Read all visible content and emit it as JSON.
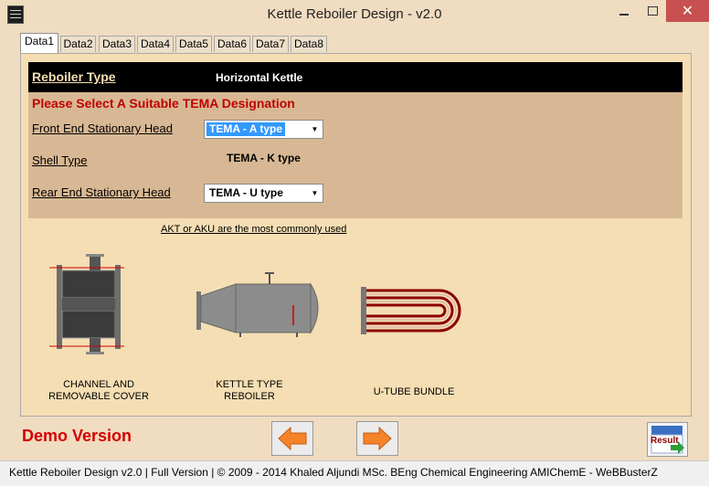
{
  "window": {
    "title": "Kettle Reboiler Design - v2.0",
    "controls": {
      "minimize": "minimize-icon",
      "maximize": "maximize-icon",
      "close": "✕"
    }
  },
  "tabs": [
    {
      "label": "Data1",
      "active": true
    },
    {
      "label": "Data2",
      "active": false
    },
    {
      "label": "Data3",
      "active": false
    },
    {
      "label": "Data4",
      "active": false
    },
    {
      "label": "Data5",
      "active": false
    },
    {
      "label": "Data6",
      "active": false
    },
    {
      "label": "Data7",
      "active": false
    },
    {
      "label": "Data8",
      "active": false
    }
  ],
  "reboiler": {
    "label": "Reboiler Type",
    "value": "Horizontal Kettle"
  },
  "tema": {
    "heading": "Please Select A Suitable TEMA Designation",
    "front_end": {
      "label": "Front End Stationary Head",
      "value": "TEMA - A type"
    },
    "shell": {
      "label": "Shell Type",
      "value": "TEMA - K type"
    },
    "rear_end": {
      "label": "Rear End Stationary Head",
      "value": "TEMA - U type"
    }
  },
  "note": "AKT or AKU are the most commonly used",
  "illustrations": {
    "channel_caption": [
      "CHANNEL AND",
      "REMOVABLE COVER"
    ],
    "kettle_caption": [
      "KETTLE TYPE",
      "REBOILER"
    ],
    "utube_caption": [
      "U-TUBE BUNDLE"
    ]
  },
  "footer": {
    "demo_label": "Demo Version",
    "result_label": "Result",
    "status": "Kettle Reboiler Design  v2.0   |  Full Version  |  © 2009 - 2014 Khaled Aljundi MSc. BEng Chemical Engineering AMIChemE - WeBBusterZ"
  },
  "colors": {
    "background": "#f0dcc0",
    "panel": "#f5deb3",
    "tema_box": "#d8b894",
    "heading_red": "#c00000",
    "demo_red": "#d40000",
    "arrow_orange": "#f5832a",
    "selection_blue": "#3399ff"
  }
}
